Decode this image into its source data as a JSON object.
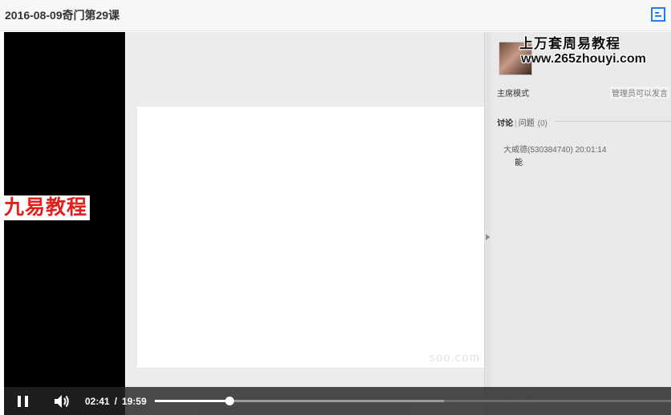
{
  "window": {
    "title": "2016-08-09奇门第29课"
  },
  "left_overlay": {
    "logo_text": "九易教程"
  },
  "whiteboard": {
    "watermark": "soo.com"
  },
  "sidebar": {
    "promo_title": "上万套周易教程",
    "promo_url": "www.265zhouyi.com",
    "mode_label": "主席模式",
    "mode_status": "管理员可以发言",
    "tabs": {
      "discussion": "讨论",
      "questions": "问题",
      "questions_count": "(0)"
    },
    "messages": [
      {
        "author": "大威德(530384740)",
        "time": "20:01:14",
        "text": "能"
      }
    ]
  },
  "player": {
    "current_time": "02:41",
    "separator": "/",
    "duration": "19:59",
    "progress_fraction": 0.144,
    "buffered_fraction": 0.56
  },
  "colors": {
    "logo_red": "#e0201c",
    "control_bar": "#242424"
  },
  "icons": {
    "window": "restore-window-icon",
    "play": "pause-icon",
    "volume": "volume-icon"
  }
}
